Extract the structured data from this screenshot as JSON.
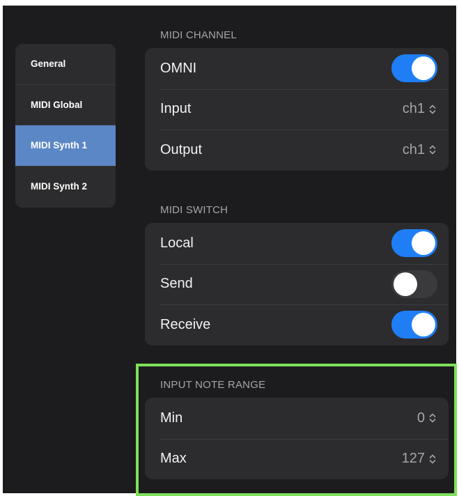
{
  "sidebar": {
    "items": [
      {
        "label": "General",
        "active": false
      },
      {
        "label": "MIDI Global",
        "active": false
      },
      {
        "label": "MIDI Synth 1",
        "active": true
      },
      {
        "label": "MIDI Synth 2",
        "active": false
      }
    ]
  },
  "midi_channel": {
    "header": "MIDI CHANNEL",
    "omni": {
      "label": "OMNI",
      "on": true
    },
    "input": {
      "label": "Input",
      "value": "ch1"
    },
    "output": {
      "label": "Output",
      "value": "ch1"
    }
  },
  "midi_switch": {
    "header": "MIDI SWITCH",
    "local": {
      "label": "Local",
      "on": true
    },
    "send": {
      "label": "Send",
      "on": false
    },
    "receive": {
      "label": "Receive",
      "on": true
    }
  },
  "input_note_range": {
    "header": "INPUT NOTE RANGE",
    "min": {
      "label": "Min",
      "value": "0"
    },
    "max": {
      "label": "Max",
      "value": "127"
    }
  },
  "colors": {
    "accent": "#1f7ef5",
    "sidebar_active": "#5c87c6",
    "highlight": "#7fe05a"
  }
}
